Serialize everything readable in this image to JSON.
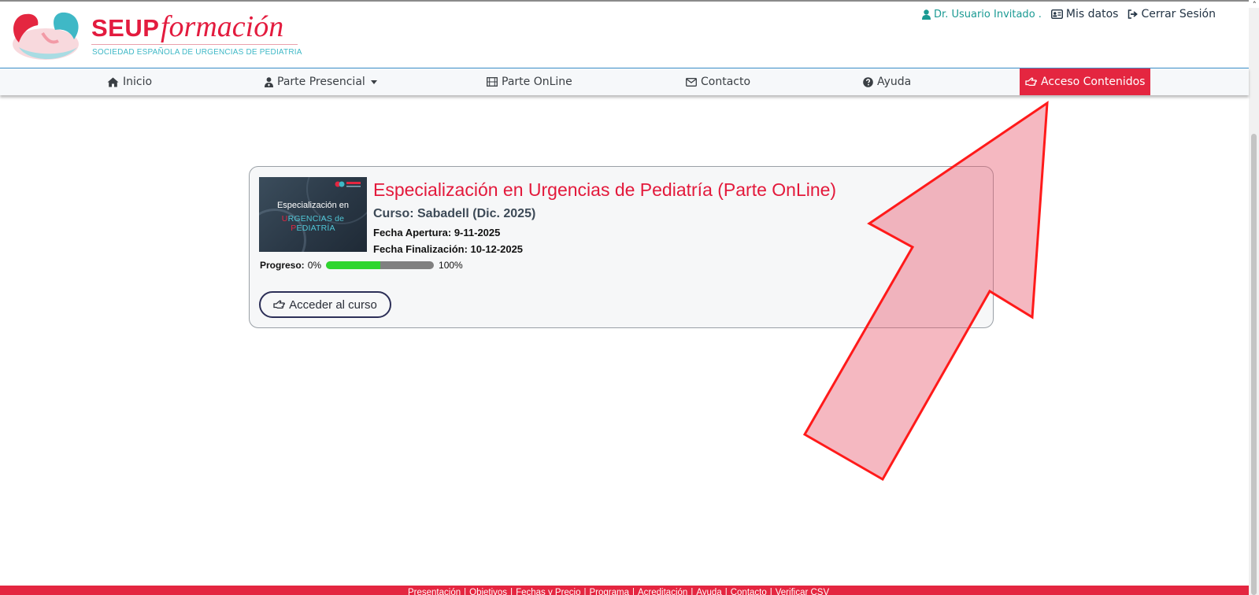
{
  "header": {
    "logo": {
      "brand": "SEUP",
      "script": "formación",
      "subtitle": "SOCIEDAD ESPAÑOLA DE URGENCIAS DE PEDIATRIA"
    },
    "user": {
      "name": "Dr. Usuario Invitado .",
      "icon": "user-icon"
    },
    "links": [
      {
        "label": "Mis datos",
        "icon": "id-card-icon"
      },
      {
        "label": "Cerrar Sesión",
        "icon": "sign-out-icon"
      }
    ]
  },
  "nav": {
    "items": [
      {
        "label": "Inicio",
        "icon": "home-icon"
      },
      {
        "label": "Parte Presencial",
        "icon": "user-md-icon",
        "dropdown": true
      },
      {
        "label": "Parte OnLine",
        "icon": "film-icon"
      },
      {
        "label": "Contacto",
        "icon": "envelope-icon"
      },
      {
        "label": "Ayuda",
        "icon": "question-circle-icon"
      },
      {
        "label": "Acceso Contenidos",
        "icon": "hand-pointer-icon",
        "active": true
      }
    ]
  },
  "course": {
    "thumbnail": {
      "line1": "Especialización en",
      "line2_a": "U",
      "line2_b": "RGENCIAS de ",
      "line2_c": "P",
      "line2_d": "EDIATRÍA"
    },
    "title": "Especialización en Urgencias de Pediatría (Parte OnLine)",
    "subtitle": "Curso: Sabadell (Dic. 2025)",
    "opening": "Fecha Apertura: 9-11-2025",
    "closing": "Fecha Finalización: 10-12-2025",
    "progress": {
      "label": "Progreso:",
      "min_label": "0%",
      "max_label": "100%",
      "value_percent": 50
    },
    "button": "Acceder al curso"
  },
  "footer": {
    "links": [
      "Presentación",
      "Objetivos",
      "Fechas y Precio",
      "Programa",
      "Acreditación",
      "Ayuda",
      "Contacto",
      "Verificar CSV"
    ],
    "separator": "|"
  },
  "colors": {
    "brand_red": "#e42640",
    "accent_teal": "#1a9a93",
    "progress_green": "#2fd62f"
  }
}
